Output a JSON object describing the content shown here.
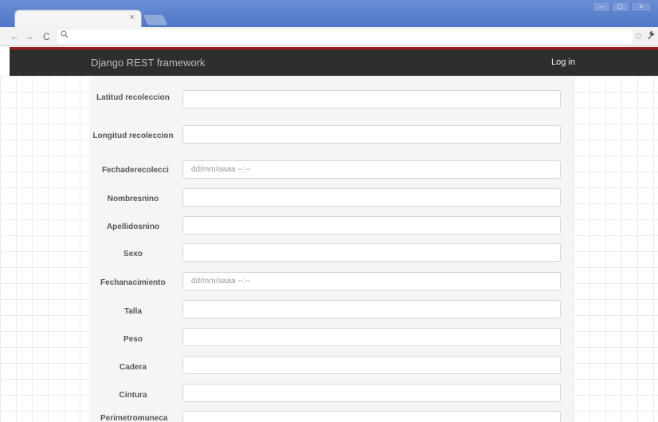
{
  "browser": {
    "tab_close": "×",
    "win_controls": {
      "minimize": "–",
      "maximize": "□",
      "close": "×"
    },
    "nav": {
      "back": "←",
      "forward": "→",
      "reload": "C"
    },
    "omnibox_search_glyph": "🔍",
    "star_glyph": "☆",
    "wrench_glyph": "🔧"
  },
  "navbar": {
    "brand": "Django REST framework",
    "login": "Log in",
    "accent_color": "#a31a1a"
  },
  "form": {
    "fields": [
      {
        "label": "Latitud recoleccion",
        "value": ""
      },
      {
        "label": "Longitud recoleccion",
        "value": ""
      },
      {
        "label": "Fechaderecolecci",
        "value": "dd/mm/aaaa --:--"
      },
      {
        "label": "Nombresnino",
        "value": ""
      },
      {
        "label": "Apellidosnino",
        "value": ""
      },
      {
        "label": "Sexo",
        "value": ""
      },
      {
        "label": "Fechanacimiento",
        "value": "dd/mm/aaaa --:--"
      },
      {
        "label": "Talla",
        "value": ""
      },
      {
        "label": "Peso",
        "value": ""
      },
      {
        "label": "Cadera",
        "value": ""
      },
      {
        "label": "Cintura",
        "value": ""
      },
      {
        "label": "Perimetromuneca",
        "value": ""
      }
    ]
  }
}
